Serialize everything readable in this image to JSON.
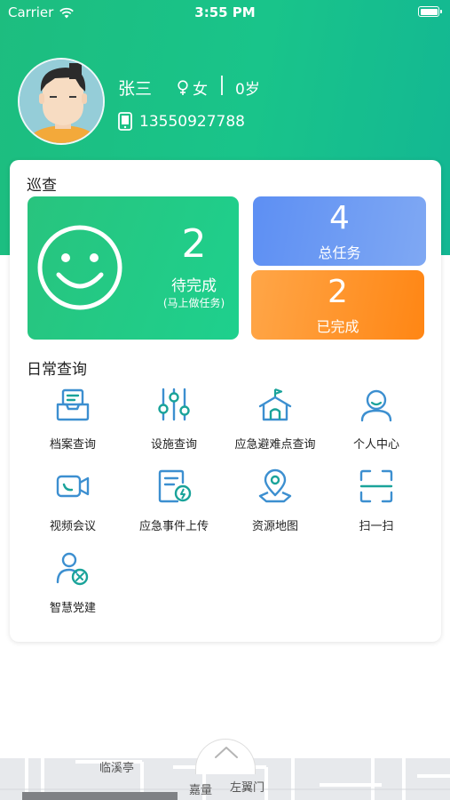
{
  "status_bar": {
    "carrier": "Carrier",
    "time": "3:55 PM"
  },
  "user": {
    "name": "张三",
    "gender": "女",
    "age": "0岁",
    "phone": "13550927788"
  },
  "patrol": {
    "title": "巡查",
    "pending": {
      "count": "2",
      "label": "待完成",
      "hint": "(马上做任务)"
    },
    "total": {
      "count": "4",
      "label": "总任务"
    },
    "done": {
      "count": "2",
      "label": "已完成"
    }
  },
  "daily": {
    "title": "日常查询",
    "items": [
      {
        "label": "档案查询",
        "icon": "archive-tray-icon"
      },
      {
        "label": "设施查询",
        "icon": "sliders-icon"
      },
      {
        "label": "应急避难点查询",
        "icon": "shelter-house-icon"
      },
      {
        "label": "个人中心",
        "icon": "person-icon"
      },
      {
        "label": "视频会议",
        "icon": "video-camera-icon"
      },
      {
        "label": "应急事件上传",
        "icon": "document-upload-icon"
      },
      {
        "label": "资源地图",
        "icon": "map-pin-icon"
      },
      {
        "label": "扫一扫",
        "icon": "scan-frame-icon"
      },
      {
        "label": "智慧党建",
        "icon": "party-member-icon"
      }
    ]
  },
  "map": {
    "labels": [
      "临溪亭",
      "嘉量",
      "左翼门"
    ]
  },
  "colors": {
    "brand_green": "#1dbd7f",
    "accent_blue": "#5d8ff3",
    "accent_orange": "#ff8614",
    "icon_blue": "#3c8fd0",
    "icon_teal": "#1aa39a"
  }
}
